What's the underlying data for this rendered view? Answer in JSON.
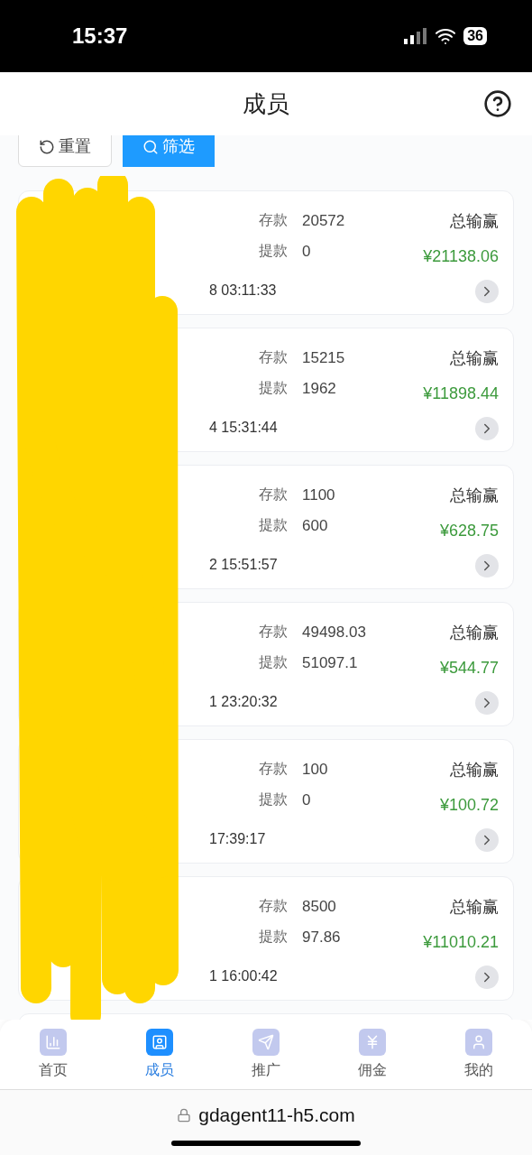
{
  "status_bar": {
    "time": "15:37",
    "battery": "36"
  },
  "header": {
    "title": "成员"
  },
  "filter_buttons": [
    {
      "kind": "reset",
      "label": "重置"
    },
    {
      "kind": "filter",
      "label": "筛选"
    }
  ],
  "members": [
    {
      "deposit_label": "存款",
      "deposit": "20572",
      "withdraw_label": "提款",
      "withdraw": "0",
      "total_label": "总输赢",
      "total": "¥21138.06",
      "time": "8 03:11:33"
    },
    {
      "deposit_label": "存款",
      "deposit": "15215",
      "withdraw_label": "提款",
      "withdraw": "1962",
      "total_label": "总输赢",
      "total": "¥11898.44",
      "time": "4 15:31:44"
    },
    {
      "deposit_label": "存款",
      "deposit": "1100",
      "withdraw_label": "提款",
      "withdraw": "600",
      "total_label": "总输赢",
      "total": "¥628.75",
      "time": "2 15:51:57"
    },
    {
      "deposit_label": "存款",
      "deposit": "49498.03",
      "withdraw_label": "提款",
      "withdraw": "51097.1",
      "total_label": "总输赢",
      "total": "¥544.77",
      "time": "1 23:20:32"
    },
    {
      "deposit_label": "存款",
      "deposit": "100",
      "withdraw_label": "提款",
      "withdraw": "0",
      "total_label": "总输赢",
      "total": "¥100.72",
      "time": "17:39:17"
    },
    {
      "deposit_label": "存款",
      "deposit": "8500",
      "withdraw_label": "提款",
      "withdraw": "97.86",
      "total_label": "总输赢",
      "total": "¥11010.21",
      "time": "1 16:00:42"
    }
  ],
  "tabs": [
    {
      "kind": "home",
      "label": "首页",
      "selected": false
    },
    {
      "kind": "members",
      "label": "成员",
      "selected": true
    },
    {
      "kind": "promo",
      "label": "推广",
      "selected": false
    },
    {
      "kind": "commission",
      "label": "佣金",
      "selected": false
    },
    {
      "kind": "mine",
      "label": "我的",
      "selected": false
    }
  ],
  "url": "gdagent11-h5.com"
}
